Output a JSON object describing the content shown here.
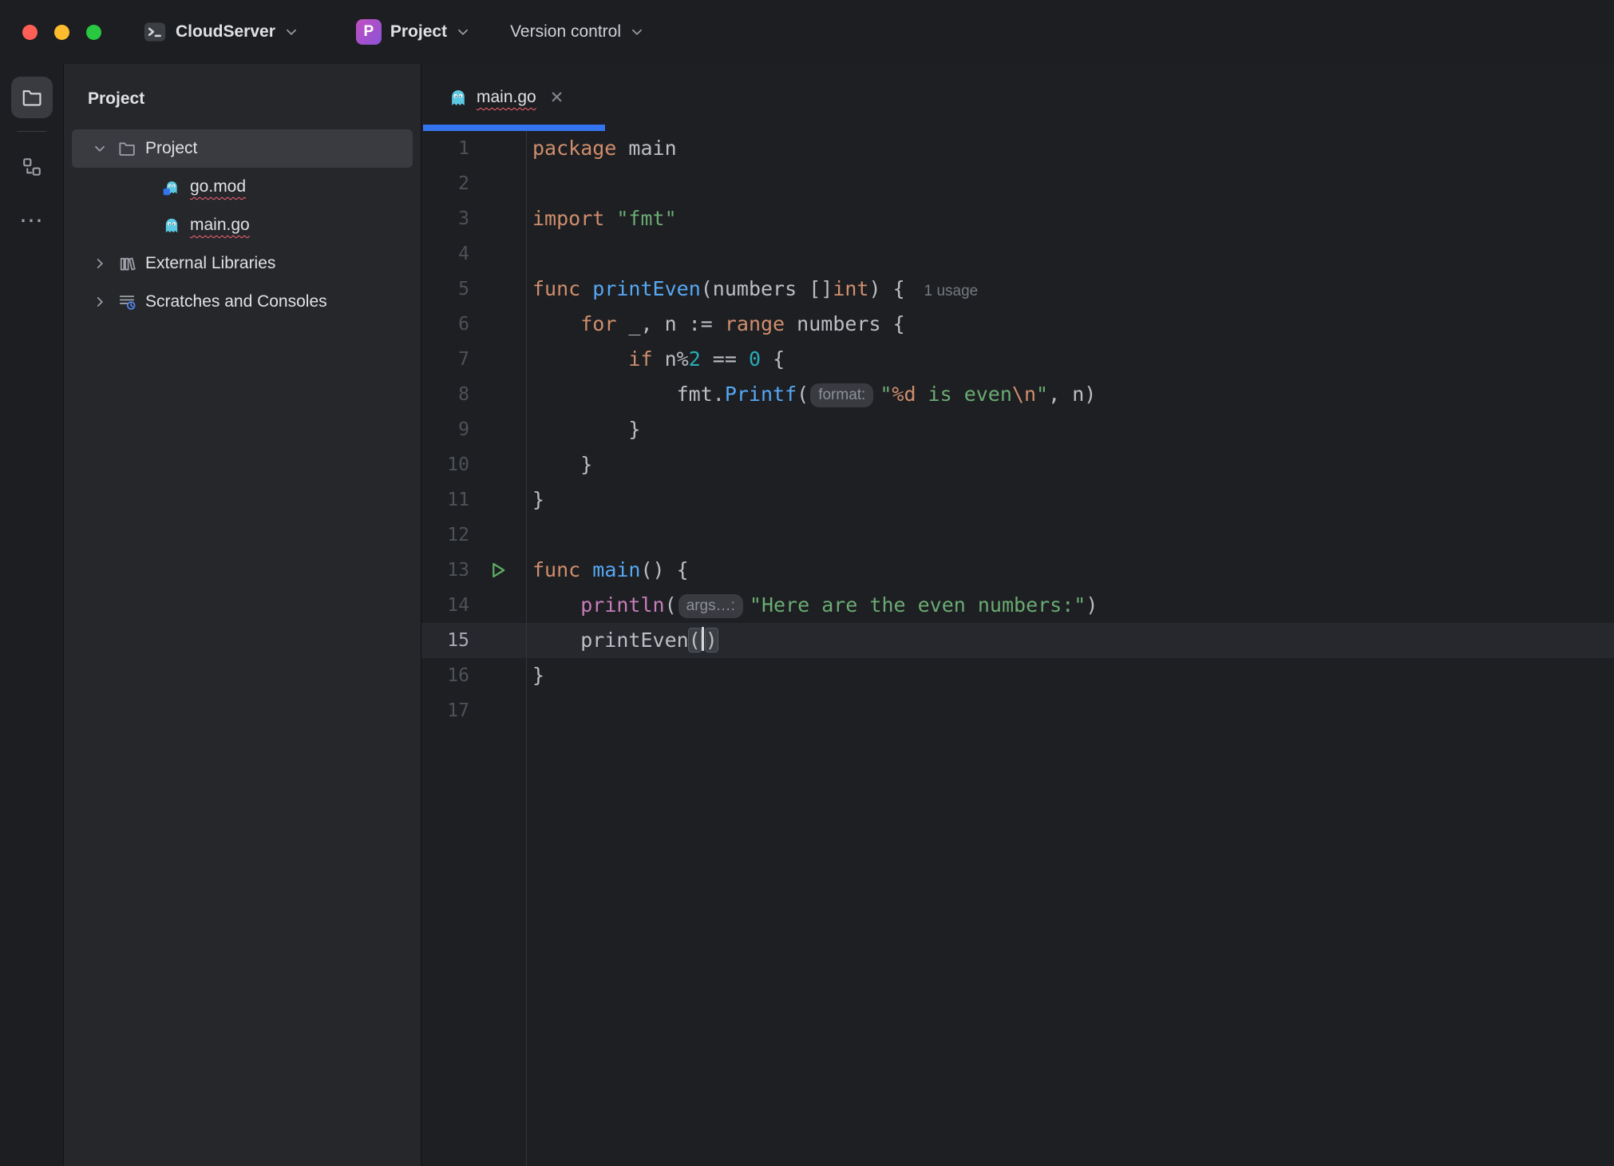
{
  "titlebar": {
    "server": {
      "label": "CloudServer"
    },
    "project": {
      "badge": "P",
      "label": "Project"
    },
    "vcs": {
      "label": "Version control"
    }
  },
  "project_panel": {
    "title": "Project",
    "tree": [
      {
        "label": "Project",
        "icon": "folder",
        "chevron": "down",
        "level": 0,
        "selected": true,
        "error": false
      },
      {
        "label": "go.mod",
        "icon": "gomod",
        "chevron": null,
        "level": 1,
        "selected": false,
        "error": true
      },
      {
        "label": "main.go",
        "icon": "go",
        "chevron": null,
        "level": 1,
        "selected": false,
        "error": true
      },
      {
        "label": "External Libraries",
        "icon": "lib",
        "chevron": "right",
        "level": 0,
        "selected": false,
        "error": false
      },
      {
        "label": "Scratches and Consoles",
        "icon": "scratch",
        "chevron": "right",
        "level": 0,
        "selected": false,
        "error": false
      }
    ]
  },
  "editor": {
    "tab": {
      "label": "main.go",
      "close_glyph": "✕",
      "error": true
    },
    "current_line": 15,
    "run_line": 13,
    "lines": [
      {
        "n": 1,
        "t": [
          [
            "kw",
            "package"
          ],
          [
            "pl",
            " main"
          ]
        ]
      },
      {
        "n": 2,
        "t": []
      },
      {
        "n": 3,
        "t": [
          [
            "kw",
            "import"
          ],
          [
            "pl",
            " "
          ],
          [
            "str",
            "\"fmt\""
          ]
        ]
      },
      {
        "n": 4,
        "t": []
      },
      {
        "n": 5,
        "t": [
          [
            "kw",
            "func"
          ],
          [
            "pl",
            " "
          ],
          [
            "fn",
            "printEven"
          ],
          [
            "pl",
            "(numbers []"
          ],
          [
            "kw",
            "int"
          ],
          [
            "pl",
            ") {"
          ],
          [
            "usage",
            "1 usage"
          ]
        ]
      },
      {
        "n": 6,
        "t": [
          [
            "pl",
            "    "
          ],
          [
            "kw",
            "for"
          ],
          [
            "pl",
            " _, n := "
          ],
          [
            "kw",
            "range"
          ],
          [
            "pl",
            " numbers {"
          ]
        ]
      },
      {
        "n": 7,
        "t": [
          [
            "pl",
            "        "
          ],
          [
            "kw",
            "if"
          ],
          [
            "pl",
            " n%"
          ],
          [
            "num",
            "2"
          ],
          [
            "pl",
            " == "
          ],
          [
            "num",
            "0"
          ],
          [
            "pl",
            " {"
          ]
        ]
      },
      {
        "n": 8,
        "t": [
          [
            "pl",
            "            fmt."
          ],
          [
            "fn",
            "Printf"
          ],
          [
            "pl",
            "("
          ],
          [
            "hint",
            "format:"
          ],
          [
            "str",
            "\""
          ],
          [
            "esc",
            "%d"
          ],
          [
            "str",
            " is even"
          ],
          [
            "esc",
            "\\n"
          ],
          [
            "str",
            "\""
          ],
          [
            "pl",
            ", n)"
          ]
        ]
      },
      {
        "n": 9,
        "t": [
          [
            "pl",
            "        }"
          ]
        ]
      },
      {
        "n": 10,
        "t": [
          [
            "pl",
            "    }"
          ]
        ]
      },
      {
        "n": 11,
        "t": [
          [
            "pl",
            "}"
          ]
        ]
      },
      {
        "n": 12,
        "t": []
      },
      {
        "n": 13,
        "run": true,
        "t": [
          [
            "kw",
            "func"
          ],
          [
            "pl",
            " "
          ],
          [
            "fn",
            "main"
          ],
          [
            "pl",
            "() {"
          ]
        ]
      },
      {
        "n": 14,
        "t": [
          [
            "pl",
            "    "
          ],
          [
            "bi",
            "println"
          ],
          [
            "pl",
            "("
          ],
          [
            "hint",
            "args…:"
          ],
          [
            "str",
            "\"Here are the even numbers:\""
          ],
          [
            "pl",
            ")"
          ]
        ]
      },
      {
        "n": 15,
        "cur": true,
        "t": [
          [
            "pl",
            "    printEven"
          ],
          [
            "par",
            "("
          ],
          [
            "caret",
            ""
          ],
          [
            "par",
            ")"
          ]
        ]
      },
      {
        "n": 16,
        "t": [
          [
            "pl",
            "}"
          ]
        ]
      },
      {
        "n": 17,
        "t": []
      }
    ]
  },
  "colors": {
    "traffic-close": "#ff5f57",
    "traffic-min": "#febc2e",
    "traffic-max": "#28c840",
    "accent": "#3574f0",
    "error": "#fa6675",
    "kw": "#cf8e6d",
    "fn": "#56a8f5",
    "str": "#6aab73",
    "num": "#2aacb8",
    "builtin": "#c77dbb",
    "text": "#bcbec4",
    "bg-editor": "#1e1f22",
    "bg-panel": "#26272b",
    "bg-selected": "#393b40",
    "bg-current-line": "#26282e",
    "run-green": "#5fad65"
  }
}
